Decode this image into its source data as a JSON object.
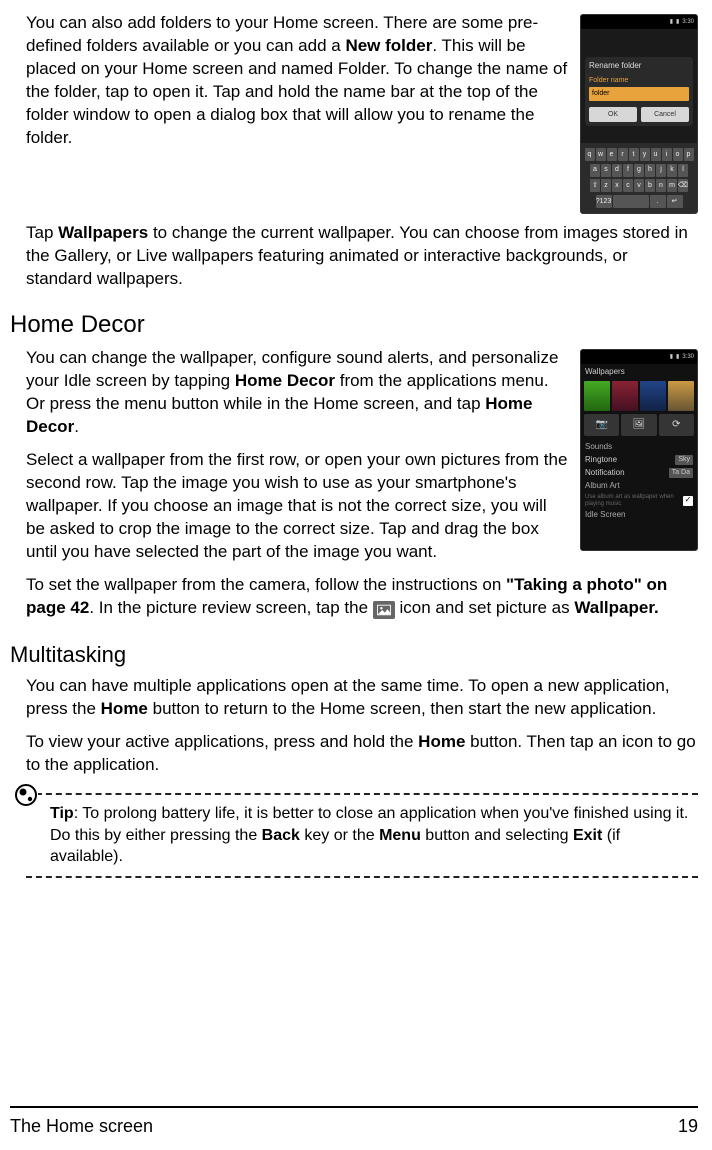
{
  "section1": {
    "para1_a": "You can also add folders to your Home screen. There are some pre-defined folders available or you can add a ",
    "new_folder": "New folder",
    "para1_b": ". This will be placed on your Home screen and named Folder. To change the name of the folder, tap to open it. Tap and hold the name bar at the top of the folder window to open a dialog box that will allow you to rename the folder.",
    "para2_a": "Tap ",
    "wallpapers": "Wallpapers",
    "para2_b": " to change the current wallpaper. You can choose from images stored in the Gallery, or Live wallpapers featuring animated or interactive backgrounds, or standard wallpapers."
  },
  "screenshot1": {
    "time": "3:30",
    "dlg_title": "Rename folder",
    "dlg_label": "Folder name",
    "dlg_value": "folder",
    "ok": "OK",
    "cancel": "Cancel",
    "kbd": [
      [
        "q",
        "w",
        "e",
        "r",
        "t",
        "y",
        "u",
        "i",
        "o",
        "p"
      ],
      [
        "a",
        "s",
        "d",
        "f",
        "g",
        "h",
        "j",
        "k",
        "l"
      ],
      [
        "⇧",
        "z",
        "x",
        "c",
        "v",
        "b",
        "n",
        "m",
        "⌫"
      ],
      [
        "?123",
        "",
        ".",
        "↵"
      ]
    ]
  },
  "home_decor": {
    "heading": "Home Decor",
    "p1_a": "You can change the wallpaper, configure sound alerts, and personalize your Idle screen by tapping ",
    "hd1": "Home Decor",
    "p1_b": " from the applications menu. Or press the menu button while in the Home screen, and tap ",
    "hd2": "Home Decor",
    "p1_c": ".",
    "p2": "Select a wallpaper from the first row, or open your own pictures from the second row. Tap the image you wish to use as your smartphone's wallpaper. If you choose an image that is not the correct size, you will be asked to crop the image to the correct size. Tap and drag the box until you have selected the part of the image you want.",
    "p3_a": "To set the wallpaper from the camera, follow the instructions on ",
    "xref": "\"Taking a photo\" on page 42",
    "p3_b": ". In the picture review screen, tap the ",
    "p3_c": " icon and set picture as ",
    "wp": "Wallpaper."
  },
  "screenshot2": {
    "time": "3:30",
    "title": "Wallpapers",
    "sounds": "Sounds",
    "ringtone_label": "Ringtone",
    "ringtone_val": "Sky",
    "notif_label": "Notification",
    "notif_val": "Ta Da",
    "album": "Album Art",
    "album_sub": "Use album art as wallpaper when playing music",
    "idle": "Idle Screen"
  },
  "multitasking": {
    "heading": "Multitasking",
    "p1_a": "You can have multiple applications open at the same time. To open a new application, press the ",
    "home1": "Home",
    "p1_b": " button to return to the Home screen, then start the new application.",
    "p2_a": "To view your active applications, press and hold the ",
    "home2": "Home",
    "p2_b": " button. Then tap an icon to go to the application."
  },
  "tip": {
    "label": "Tip",
    "text_a": ": To prolong battery life, it is better to close an application when you've finished using it. Do this by either pressing the ",
    "back": "Back",
    "text_b": " key or the ",
    "menu": "Menu",
    "text_c": " button and selecting ",
    "exit": "Exit",
    "text_d": " (if available)."
  },
  "footer": {
    "left": "The Home screen",
    "right": "19"
  }
}
